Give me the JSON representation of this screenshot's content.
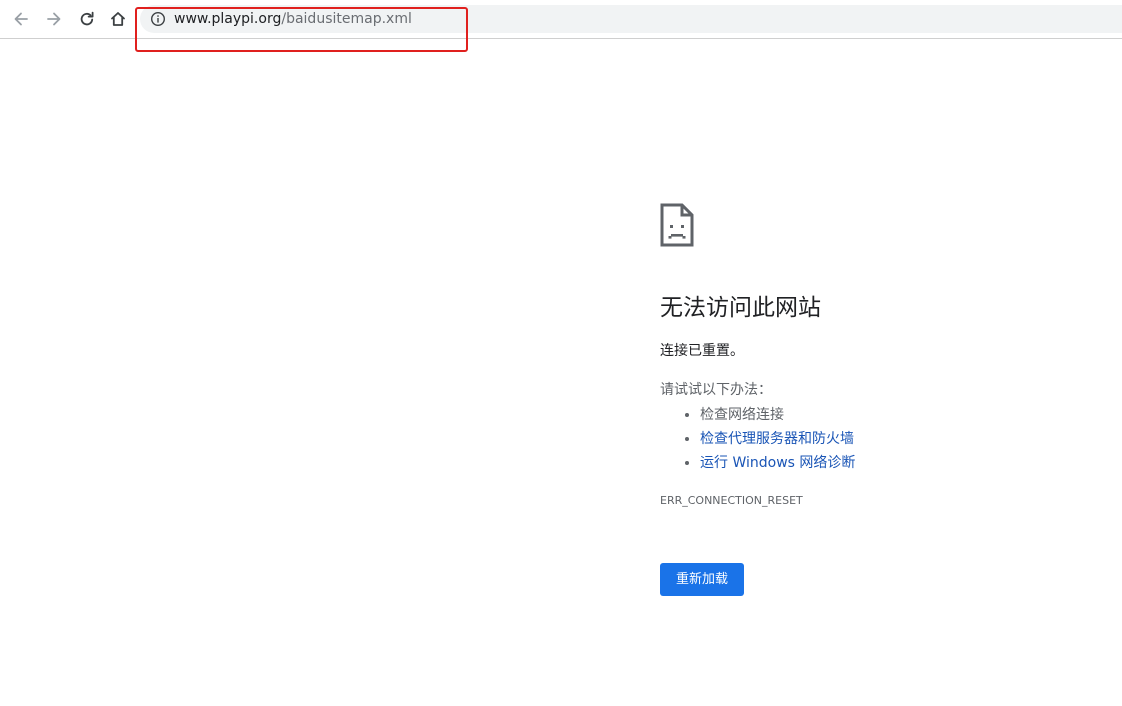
{
  "toolbar": {
    "icons": [
      "back-arrow-icon",
      "forward-arrow-icon",
      "reload-icon",
      "home-icon",
      "info-icon"
    ],
    "url_host": "www.playpi.org",
    "url_path": "/baidusitemap.xml"
  },
  "error_page": {
    "icon": "sad-document-icon",
    "title": "无法访问此网站",
    "subtitle": "连接已重置。",
    "try_heading": "请试试以下办法：",
    "suggestions": [
      {
        "text": "检查网络连接",
        "link": false
      },
      {
        "text": "检查代理服务器和防火墙",
        "link": true
      },
      {
        "text": "运行 Windows 网络诊断",
        "link": true
      }
    ],
    "error_code": "ERR_CONNECTION_RESET",
    "reload_label": "重新加载"
  },
  "colors": {
    "annotation_box": "#e0201e",
    "link": "#1a55b6",
    "button": "#1a73e8",
    "omnibox_bg": "#f1f3f4"
  }
}
